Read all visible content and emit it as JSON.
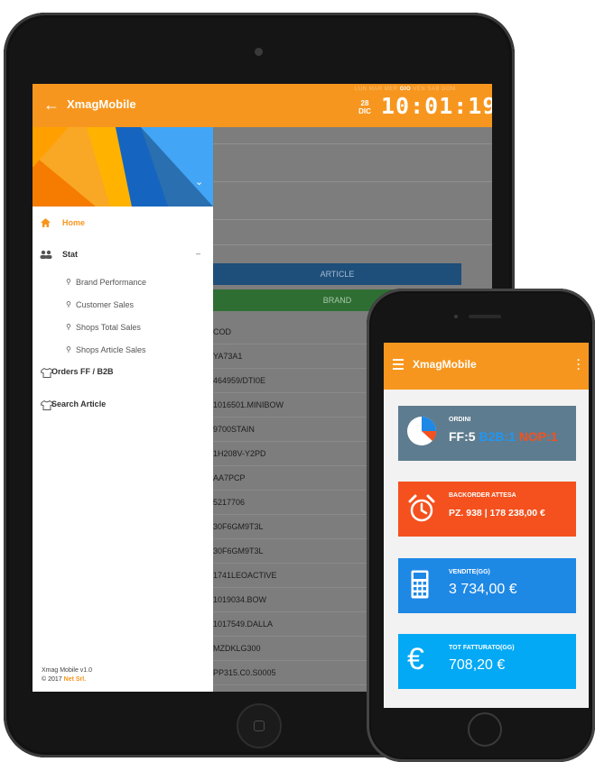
{
  "tablet": {
    "app_title": "XmagMobile",
    "weekdays": [
      "LUN",
      "MAR",
      "MER",
      "GIO",
      "VEN",
      "SAB",
      "DOM"
    ],
    "date_day": "28",
    "date_month": "DIC",
    "clock": "10:01:19",
    "drawer": {
      "items": [
        {
          "label": "Home",
          "icon": "home-icon"
        },
        {
          "label": "Stat",
          "icon": "people-icon",
          "toggle": "–"
        },
        {
          "label": "Brand Performance",
          "icon": "search-icon"
        },
        {
          "label": "Customer Sales",
          "icon": "search-icon"
        },
        {
          "label": "Shops Total Sales",
          "icon": "search-icon"
        },
        {
          "label": "Shops Article Sales",
          "icon": "search-icon"
        },
        {
          "label": "Orders FF / B2B",
          "icon": "shirt-icon"
        },
        {
          "label": "Search Article",
          "icon": "shirt-icon"
        }
      ],
      "footer_version": "Xmag Mobile v1.0",
      "footer_copy_prefix": "© 2017",
      "footer_company": "Net Srl."
    },
    "buttons": {
      "article": "ARTICLE",
      "brand": "BRAND"
    },
    "codes": [
      "COD",
      "YA73A1",
      "464959/DTI0E",
      "1016501.MINIBOW",
      "9700STAIN",
      "1H208V-Y2PD",
      "AA7PCP",
      "5217706",
      "30F6GM9T3L",
      "30F6GM9T3L",
      "1741LEOACTIVE",
      "1019034.BOW",
      "1017549.DALLA",
      "MZDKLG300",
      "PP315.C0.S0005"
    ]
  },
  "phone": {
    "app_title": "XmagMobile",
    "cards": [
      {
        "label": "ORDINI",
        "value_parts": [
          "FF:5 ",
          "B2B:1 ",
          "NOP:1"
        ],
        "color": "#5e7c8f"
      },
      {
        "label": "BACKORDER ATTESA",
        "value": "PZ. 938 | 178 238,00 €",
        "color": "#f4511e"
      },
      {
        "label": "VENDITE(GG)",
        "value": "3 734,00 €",
        "color": "#1e88e5"
      },
      {
        "label": "TOT FATTURATO(GG)",
        "value": "708,20 €",
        "color": "#03a9f4"
      }
    ]
  },
  "colors": {
    "accent": "#f7961e",
    "blue_button": "#1e4e7a",
    "green_button": "#2f6e33"
  }
}
